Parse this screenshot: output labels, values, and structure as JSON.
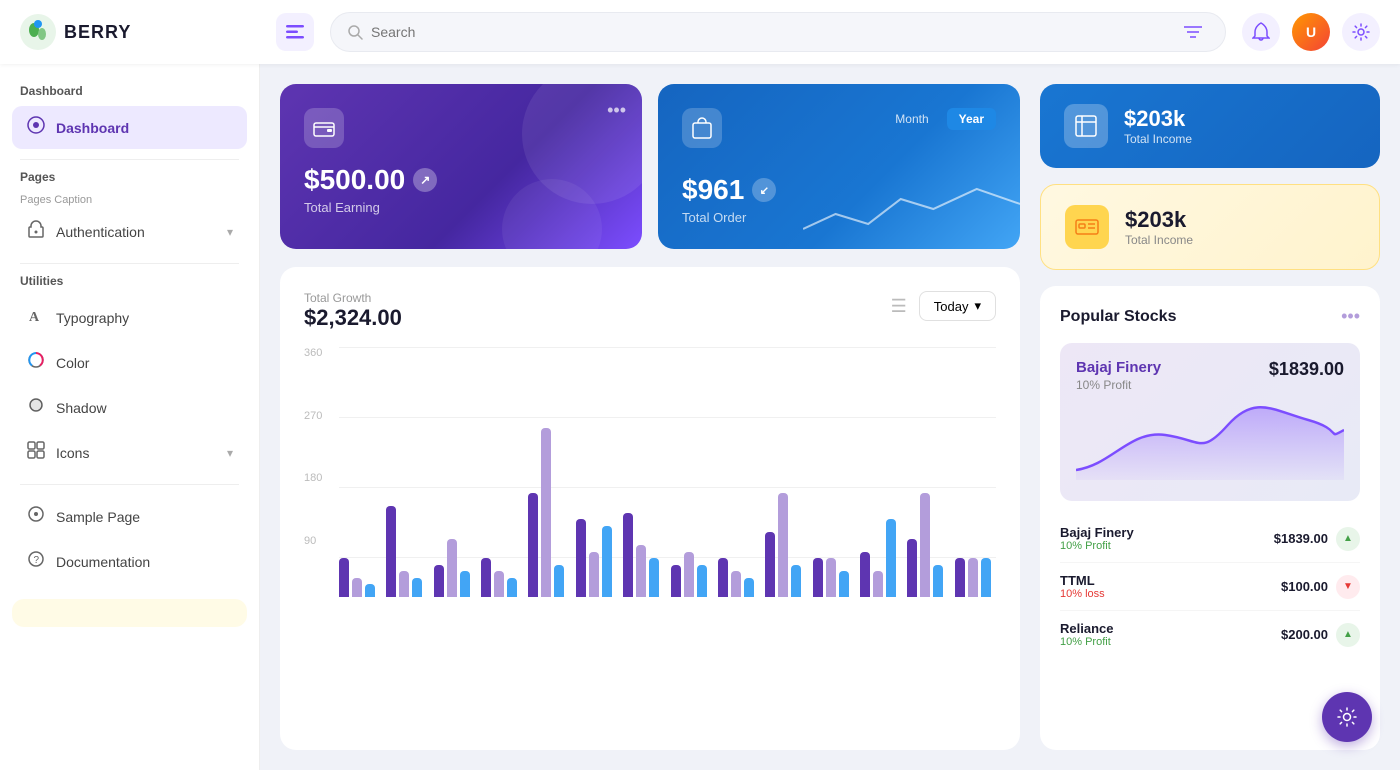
{
  "topbar": {
    "logo_text": "BERRY",
    "search_placeholder": "Search",
    "hamburger_label": "menu",
    "bell_icon": "🔔",
    "gear_icon": "⚙️"
  },
  "sidebar": {
    "section_dashboard": "Dashboard",
    "item_dashboard": "Dashboard",
    "section_pages": "Pages",
    "section_pages_caption": "Pages Caption",
    "item_authentication": "Authentication",
    "section_utilities": "Utilities",
    "item_typography": "Typography",
    "item_color": "Color",
    "item_shadow": "Shadow",
    "item_icons": "Icons",
    "item_sample": "Sample Page",
    "item_docs": "Documentation"
  },
  "card_earning": {
    "amount": "$500.00",
    "label": "Total Earning",
    "icon": "💳",
    "dots": "•••"
  },
  "card_order": {
    "amount": "$961",
    "label": "Total Order",
    "icon": "🛍️",
    "toggle_month": "Month",
    "toggle_year": "Year"
  },
  "card_total_income_blue": {
    "amount": "$203k",
    "label": "Total Income",
    "icon": "📊"
  },
  "card_total_income_yellow": {
    "amount": "$203k",
    "label": "Total Income",
    "icon": "🏧"
  },
  "chart": {
    "title": "Total Growth",
    "total": "$2,324.00",
    "filter_btn": "Today",
    "y_labels": [
      "360",
      "270",
      "180",
      "90",
      ""
    ],
    "bars": [
      {
        "purple": 30,
        "light": 15,
        "blue": 10
      },
      {
        "purple": 70,
        "light": 20,
        "blue": 15
      },
      {
        "purple": 25,
        "light": 45,
        "blue": 20
      },
      {
        "purple": 30,
        "light": 20,
        "blue": 15
      },
      {
        "purple": 80,
        "light": 130,
        "blue": 25
      },
      {
        "purple": 60,
        "light": 35,
        "blue": 55
      },
      {
        "purple": 65,
        "light": 40,
        "blue": 30
      },
      {
        "purple": 25,
        "light": 35,
        "blue": 25
      },
      {
        "purple": 30,
        "light": 20,
        "blue": 15
      },
      {
        "purple": 50,
        "light": 80,
        "blue": 25
      },
      {
        "purple": 30,
        "light": 30,
        "blue": 20
      },
      {
        "purple": 35,
        "light": 20,
        "blue": 60
      },
      {
        "purple": 45,
        "light": 80,
        "blue": 25
      },
      {
        "purple": 30,
        "light": 30,
        "blue": 30
      }
    ]
  },
  "stocks": {
    "title": "Popular Stocks",
    "featured_name": "Bajaj Finery",
    "featured_profit": "10% Profit",
    "featured_price": "$1839.00",
    "list": [
      {
        "name": "Bajaj Finery",
        "change": "10% Profit",
        "price": "$1839.00",
        "up": true
      },
      {
        "name": "TTML",
        "change": "10% loss",
        "price": "$100.00",
        "up": false
      },
      {
        "name": "Reliance",
        "change": "10% Profit",
        "price": "$200.00",
        "up": true
      }
    ]
  }
}
